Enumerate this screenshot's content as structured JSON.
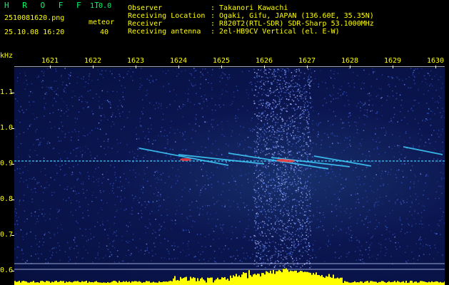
{
  "header": {
    "logo": "H R O F F T",
    "version": "1.0.0",
    "filename": "2510081620.png",
    "meteor_label": "meteor",
    "timestamp": "25.10.08 16:20",
    "meteor_count": "40"
  },
  "info": [
    {
      "key": "Observer",
      "value": ": Takanori Kawachi"
    },
    {
      "key": "Receiving Location",
      "value": ": Ogaki, Gifu, JAPAN (136.60E, 35.35N)"
    },
    {
      "key": "Receiver",
      "value": ": R820T2(RTL-SDR) SDR-Sharp 53.1000MHz"
    },
    {
      "key": "Receiving antenna",
      "value": ": 2el-HB9CV Vertical (el. E-W)"
    }
  ],
  "axes": {
    "y_unit": "kHz",
    "x_ticks": [
      "1621",
      "1622",
      "1623",
      "1624",
      "1625",
      "1626",
      "1627",
      "1628",
      "1629",
      "1630"
    ],
    "y_ticks": [
      "1.1",
      "1.0",
      "0.9",
      "0.8",
      "0.7",
      "0.6"
    ]
  },
  "colors": {
    "background": "#000000",
    "plot_bg": "#0b1650",
    "label_green": "#00ff66",
    "label_yellow": "#ffff00",
    "noise": "#3050c0",
    "signal": "#40d0ff",
    "hot": "#ff4040",
    "meter": "#ffff00"
  }
}
